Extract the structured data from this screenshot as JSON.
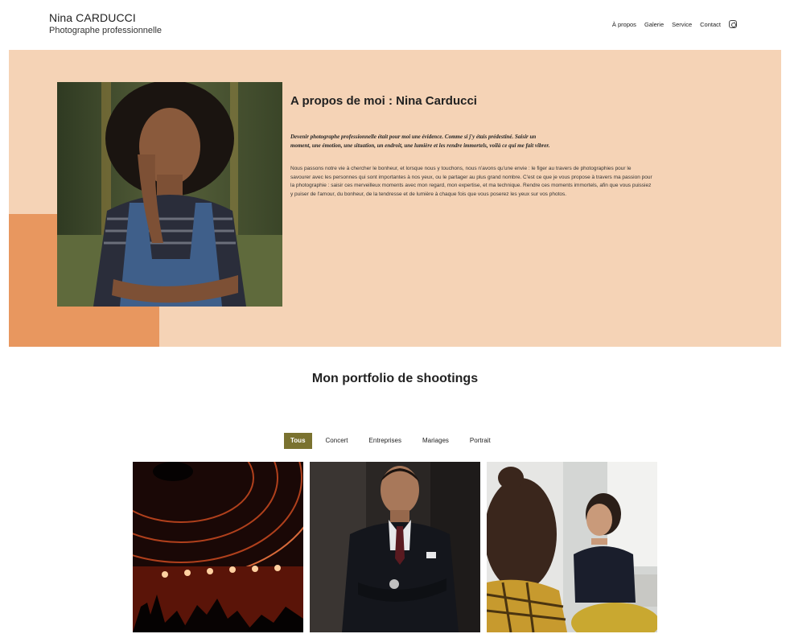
{
  "header": {
    "name": "Nina CARDUCCI",
    "subtitle": "Photographe professionnelle",
    "nav": [
      "À propos",
      "Galerie",
      "Service",
      "Contact"
    ],
    "social_icon": "instagram-icon"
  },
  "about": {
    "title": "A propos de moi : Nina Carducci",
    "quote": "Devenir photographe professionnelle était pour moi une évidence. Comme si j'y étais prédestiné. Saisir un moment, une émotion, une situation, un endroit, une lumière et les rendre immortels, voilà ce qui me fait vibrer.",
    "body": "Nous passons notre vie à chercher le bonheur, et lorsque nous y touchons, nous n'avons qu'une envie : le figer au travers de photographies pour le savourer avec les personnes qui sont importantes à nos yeux, ou le partager au plus grand nombre. C'est ce que je vous propose à travers ma passion pour la photographie : saisir ces merveilleux moments avec mon regard, mon expertise, et ma technique. Rendre ces moments immortels, afin que vous puissiez y puiser de l'amour, du bonheur, de la tendresse et de lumière à chaque fois que vous poserez les yeux sur vos photos."
  },
  "portfolio": {
    "title": "Mon portfolio de shootings",
    "filters": [
      "Tous",
      "Concert",
      "Entreprises",
      "Mariages",
      "Portrait"
    ],
    "active_filter": "Tous"
  },
  "colors": {
    "about_bg": "#f5d3b6",
    "accent": "#e8975f",
    "filter_active": "#7a7230"
  }
}
